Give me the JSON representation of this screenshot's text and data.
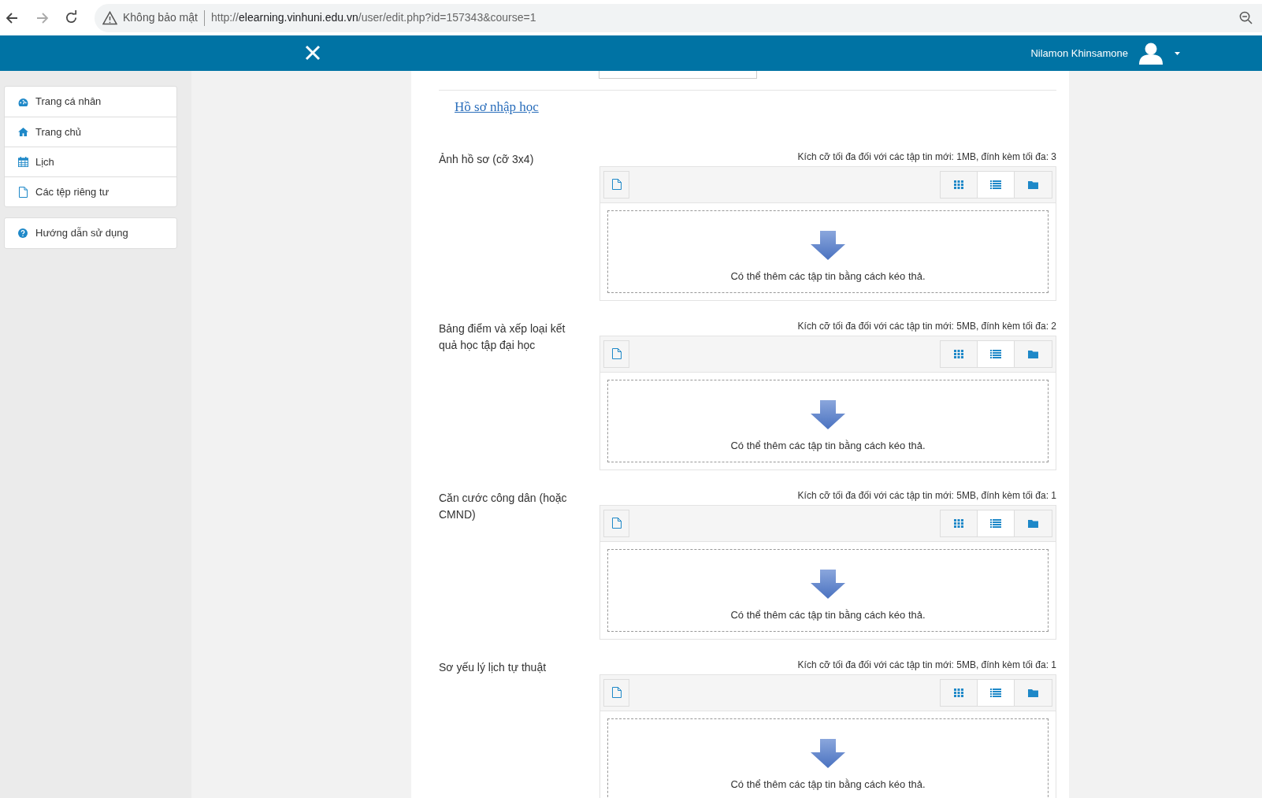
{
  "browser": {
    "security": "Không bảo mật",
    "url": {
      "scheme": "http://",
      "host": "elearning.vinhuni.edu.vn",
      "path": "/user/edit.php?id=157343&course=1"
    }
  },
  "header": {
    "user_name": "Nilamon Khinsamone"
  },
  "sidebar": {
    "groups": [
      {
        "items": [
          {
            "kind": "dashboard",
            "label": "Trang cá nhân"
          },
          {
            "kind": "home",
            "label": "Trang chủ"
          },
          {
            "kind": "calendar",
            "label": "Lịch"
          },
          {
            "kind": "file",
            "label": "Các tệp riêng tư"
          }
        ]
      },
      {
        "items": [
          {
            "kind": "help",
            "label": "Hướng dẫn sử dụng"
          }
        ]
      }
    ]
  },
  "section_link": "Hồ sơ nhập học",
  "fields": [
    {
      "label": "Ảnh hồ sơ (cỡ 3x4)",
      "limit": "Kích cỡ tối đa đối với các tập tin mới: 1MB, đính kèm tối đa: 3",
      "drop_text": "Có thể thêm các tập tin bằng cách kéo thả."
    },
    {
      "label": "Bảng điểm và xếp loại kết quả học tập đại học",
      "limit": "Kích cỡ tối đa đối với các tập tin mới: 5MB, đính kèm tối đa: 2",
      "drop_text": "Có thể thêm các tập tin bằng cách kéo thả."
    },
    {
      "label": "Căn cước công dân (hoặc CMND)",
      "limit": "Kích cỡ tối đa đối với các tập tin mới: 5MB, đính kèm tối đa: 1",
      "drop_text": "Có thể thêm các tập tin bằng cách kéo thả."
    },
    {
      "label": "Sơ yếu lý lịch tự thuật",
      "limit": "Kích cỡ tối đa đối với các tập tin mới: 5MB, đính kèm tối đa: 1",
      "drop_text": "Có thể thêm các tập tin bằng cách kéo thả."
    }
  ]
}
